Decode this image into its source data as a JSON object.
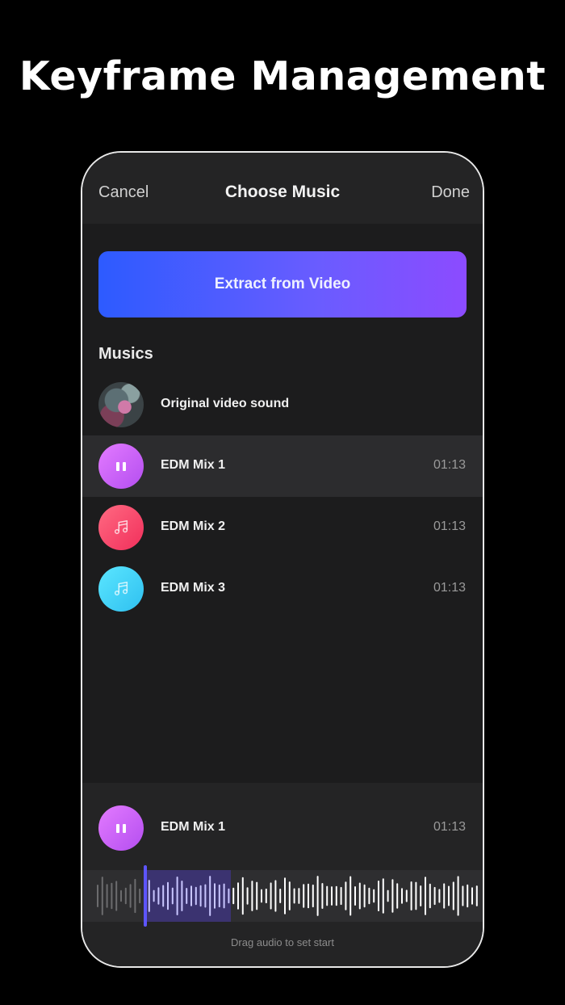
{
  "headline": "Keyframe Management",
  "navbar": {
    "cancel": "Cancel",
    "title": "Choose Music",
    "done": "Done"
  },
  "extract_button": "Extract from Video",
  "section_title": "Musics",
  "tracks": [
    {
      "name": "Original video sound",
      "duration": "",
      "icon": "video-thumbnail"
    },
    {
      "name": "EDM Mix 1",
      "duration": "01:13",
      "icon": "pause-icon",
      "color": "#c65cf5"
    },
    {
      "name": "EDM Mix 2",
      "duration": "01:13",
      "icon": "music-note-icon",
      "color": "#f5456b"
    },
    {
      "name": "EDM Mix 3",
      "duration": "01:13",
      "icon": "music-note-icon",
      "color": "#42d2f7"
    }
  ],
  "player": {
    "name": "EDM Mix 1",
    "duration": "01:13",
    "icon": "pause-icon"
  },
  "waveform_hint": "Drag audio to set start",
  "colors": {
    "accent": "#5d55ff",
    "gradient_start": "#2d5bff",
    "gradient_end": "#8c4bff"
  }
}
